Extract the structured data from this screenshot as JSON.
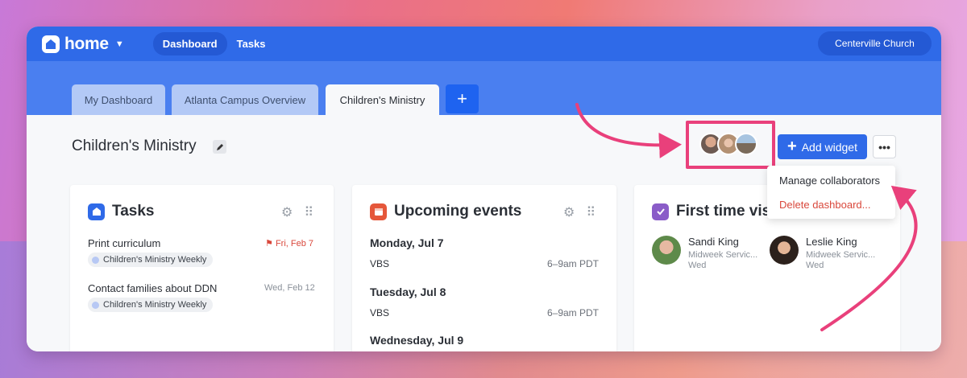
{
  "app": {
    "name": "home",
    "org": "Centerville Church"
  },
  "nav": [
    "Dashboard",
    "Tasks"
  ],
  "tabs": [
    "My Dashboard",
    "Atlanta Campus Overview",
    "Children's Ministry"
  ],
  "tab_add": "+",
  "page": {
    "title": "Children's Ministry",
    "add_widget": "Add widget",
    "more": "•••",
    "menu": [
      "Manage collaborators",
      "Delete dashboard..."
    ]
  },
  "widgets": {
    "tasks": {
      "title": "Tasks",
      "items": [
        {
          "name": "Print curriculum",
          "date": "Fri, Feb 7",
          "tag": "Children's Ministry Weekly"
        },
        {
          "name": "Contact families about DDN",
          "date": "Wed, Feb 12",
          "tag": "Children's Ministry Weekly"
        }
      ]
    },
    "events": {
      "title": "Upcoming events",
      "days": [
        {
          "day": "Monday, Jul 7",
          "name": "VBS",
          "time": "6–9am PDT"
        },
        {
          "day": "Tuesday, Jul 8",
          "name": "VBS",
          "time": "6–9am PDT"
        },
        {
          "day": "Wednesday, Jul 9"
        }
      ]
    },
    "visitors": {
      "title": "First time vis",
      "people": [
        {
          "name": "Sandi King",
          "service": "Midweek Servic...",
          "day": "Wed"
        },
        {
          "name": "Leslie King",
          "service": "Midweek Servic...",
          "day": "Wed"
        }
      ]
    }
  },
  "colors": {
    "brand": "#2f6ae8",
    "highlight": "#e9407b",
    "danger": "#d9473b"
  }
}
